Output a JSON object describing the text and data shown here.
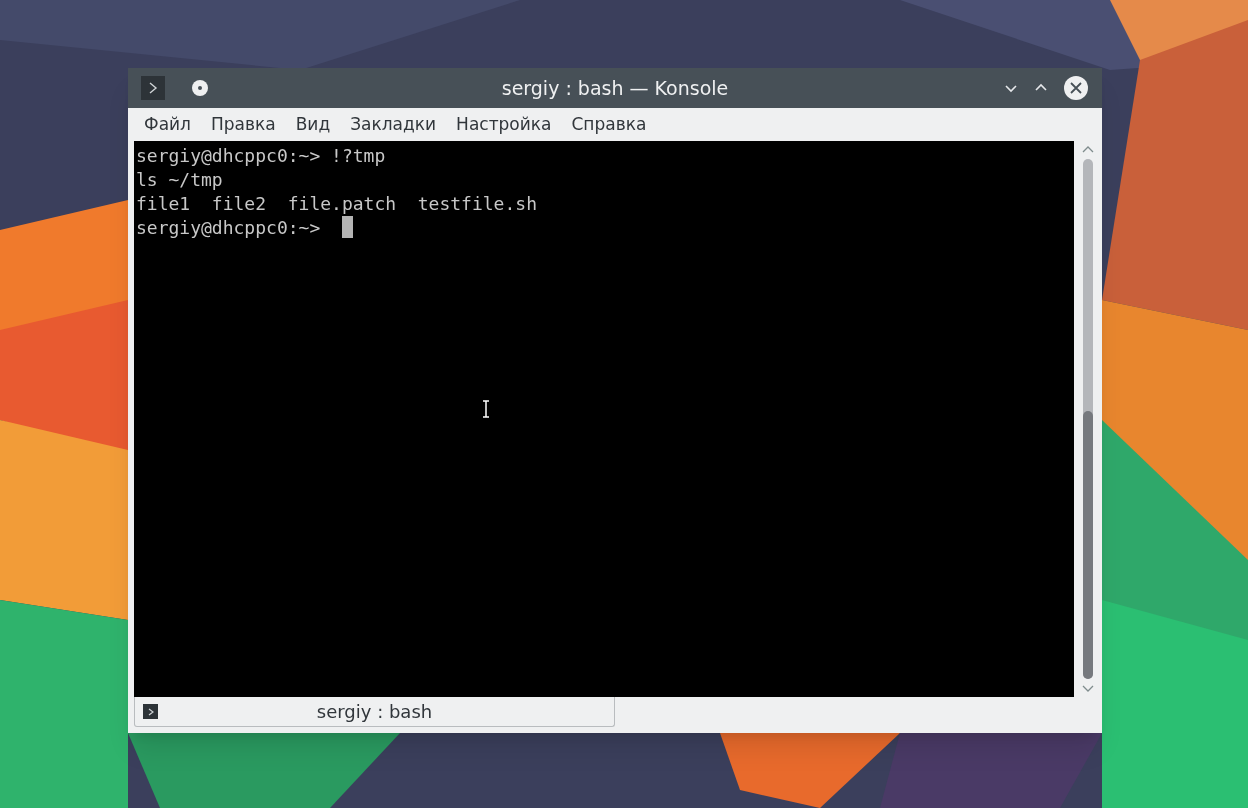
{
  "window": {
    "title": "sergiy : bash — Konsole"
  },
  "menu": [
    "Файл",
    "Правка",
    "Вид",
    "Закладки",
    "Настройка",
    "Справка"
  ],
  "terminal": {
    "lines": [
      "sergiy@dhcppc0:~> !?tmp",
      "ls ~/tmp",
      "file1  file2  file.patch  testfile.sh",
      "sergiy@dhcppc0:~> "
    ],
    "cursor_visible": true
  },
  "tabs": [
    {
      "label": "sergiy : bash",
      "selected": true
    }
  ]
}
